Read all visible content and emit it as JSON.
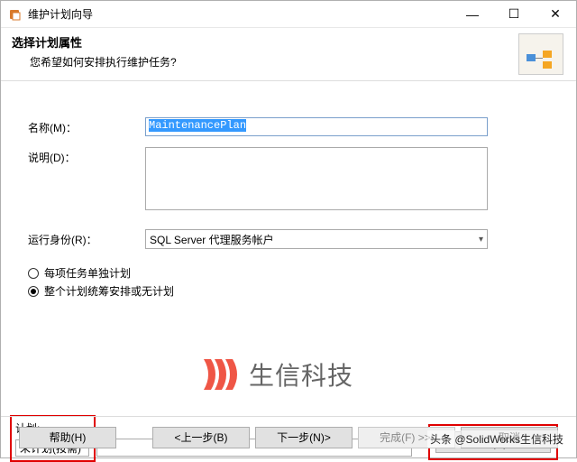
{
  "window": {
    "title": "维护计划向导"
  },
  "header": {
    "title": "选择计划属性",
    "subtitle": "您希望如何安排执行维护任务?"
  },
  "form": {
    "name_label": "名称(M)：",
    "name_value": "MaintenancePlan",
    "desc_label": "说明(D)：",
    "desc_value": "",
    "runas_label": "运行身份(R)：",
    "runas_value": "SQL Server 代理服务帐户"
  },
  "radios": {
    "opt1": "每项任务单独计划",
    "opt2": "整个计划统筹安排或无计划"
  },
  "plan": {
    "section_label": "计划:",
    "value": "未计划(按需)",
    "change_label": "更改(C)..."
  },
  "footer": {
    "help": "帮助(H)",
    "back": "上一步(B)",
    "next": "下一步(N)",
    "finish": "完成(F) >>|",
    "cancel": "取消"
  },
  "watermark": {
    "text": "生信科技"
  },
  "credit": "头条 @SolidWorks生信科技"
}
